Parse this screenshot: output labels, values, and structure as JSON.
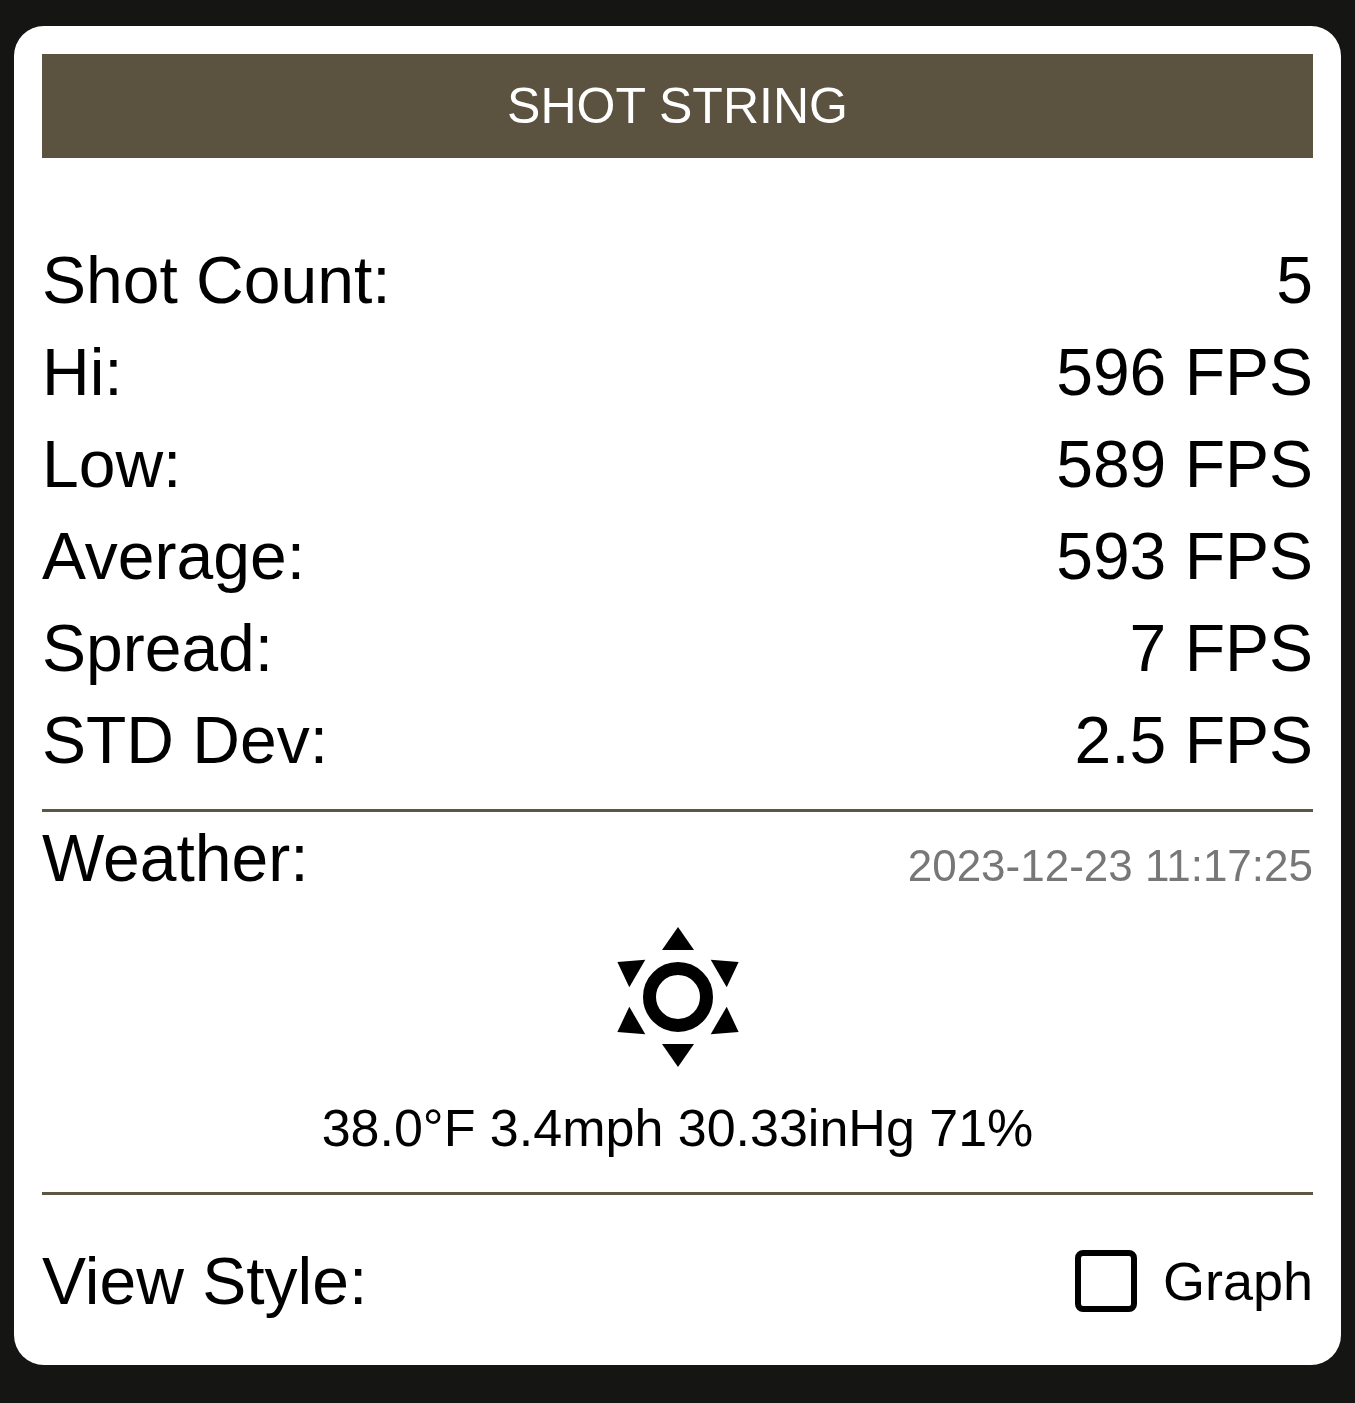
{
  "header": {
    "title": "SHOT STRING"
  },
  "stats": [
    {
      "label": "Shot Count:",
      "value": "5"
    },
    {
      "label": "Hi:",
      "value": "596 FPS"
    },
    {
      "label": "Low:",
      "value": "589 FPS"
    },
    {
      "label": "Average:",
      "value": "593 FPS"
    },
    {
      "label": "Spread:",
      "value": "7 FPS"
    },
    {
      "label": "STD Dev:",
      "value": "2.5 FPS"
    }
  ],
  "weather": {
    "label": "Weather:",
    "timestamp": "2023-12-23 11:17:25",
    "summary": "38.0°F 3.4mph 30.33inHg 71%"
  },
  "view_style": {
    "label": "View Style:",
    "option": {
      "label": "Graph",
      "checked": false
    }
  }
}
